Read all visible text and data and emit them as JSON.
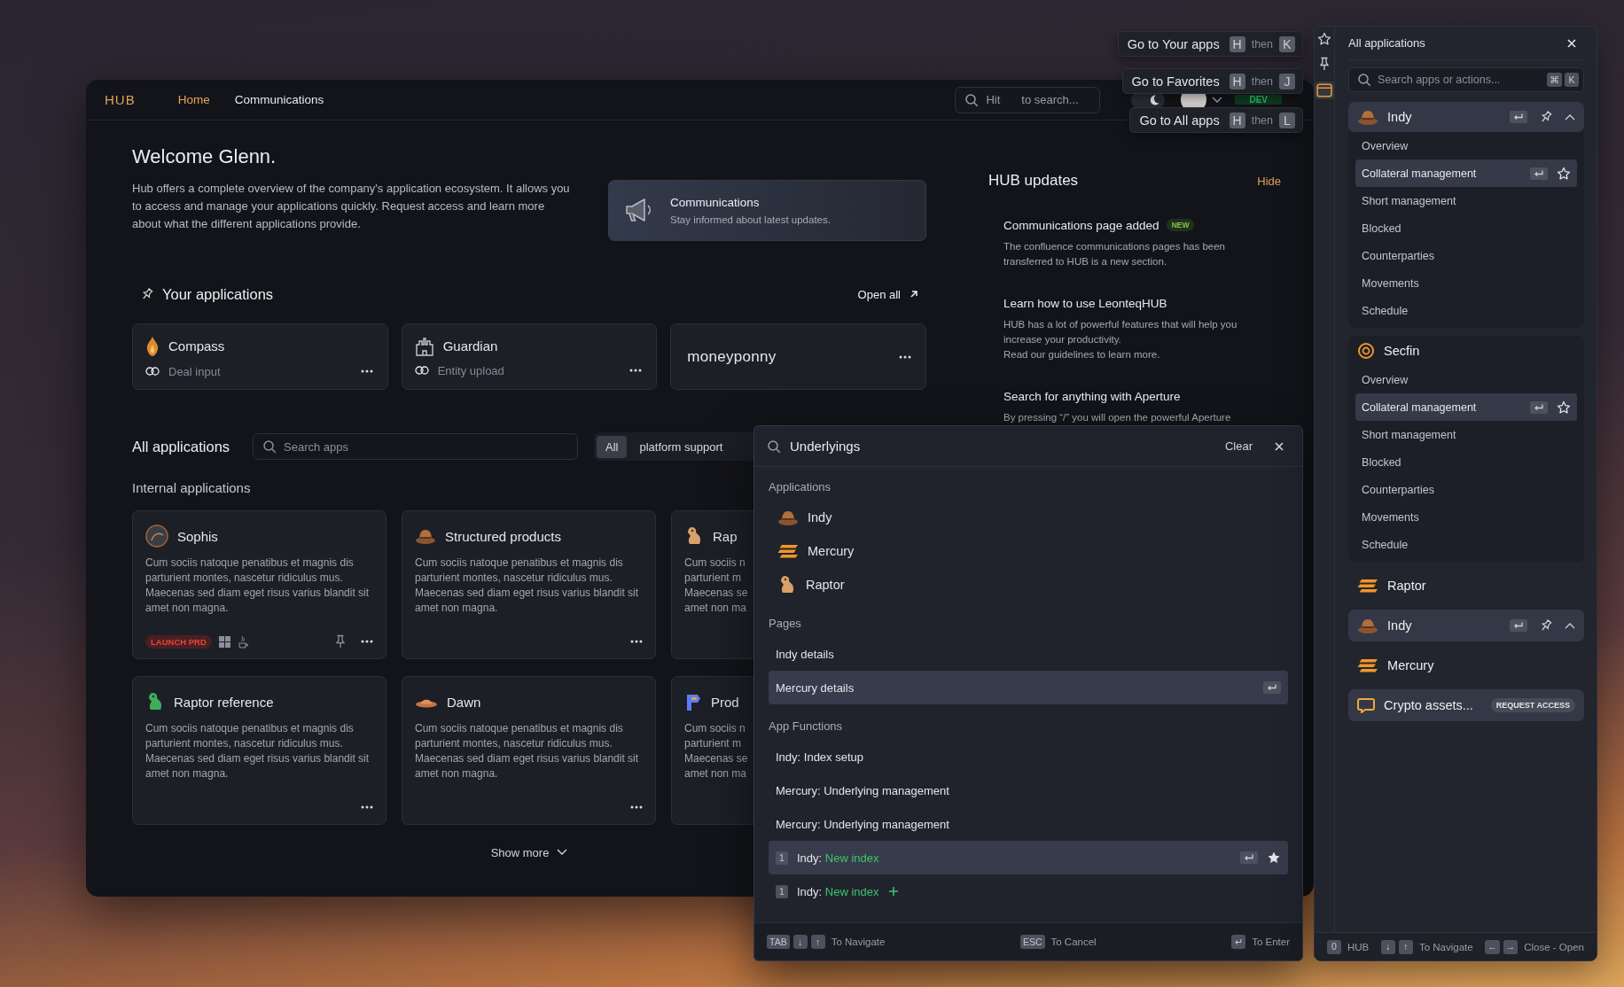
{
  "header": {
    "logo": "HUB",
    "nav": [
      {
        "label": "Home",
        "selected": true
      },
      {
        "label": "Communications",
        "selected": false
      }
    ],
    "search": {
      "hint": "Hit",
      "hint_end": "to search..."
    },
    "theme_toggle": {
      "on": true
    },
    "environment": "DEV"
  },
  "welcome": {
    "title": "Welcome Glenn.",
    "text": "Hub offers a complete overview of the company's application ecosystem. It allows you to access and manage your applications quickly. Request access and learn more about what the different applications provide."
  },
  "promo": {
    "title": "Communications",
    "subtitle": "Stay informed about latest updates."
  },
  "your_applications": {
    "title": "Your applications",
    "open_all": "Open all",
    "apps": [
      {
        "kind": "flame",
        "name": "Compass",
        "link": "Deal input"
      },
      {
        "kind": "castle",
        "name": "Guardian",
        "link": "Entity upload"
      },
      {
        "kind": "wordmark",
        "name": "moneyponny"
      }
    ]
  },
  "all_applications": {
    "title": "All applications",
    "search": {
      "placeholder": "Search apps"
    },
    "filters": [
      {
        "label": "All",
        "selected": true
      },
      {
        "label": "platform support",
        "selected": false
      }
    ],
    "section": "Internal applications",
    "cards": [
      {
        "kind": "sophis",
        "name": "Sophis",
        "description": "Cum sociis natoque penatibus et magnis dis parturient montes, nascetur ridiculus mus. Maecenas sed diam eget risus varius blandit sit amet non magna.",
        "launch_badge": "LAUNCH PRD",
        "platform_icons": true,
        "pinned": true
      },
      {
        "kind": "hat",
        "name": "Structured products",
        "description": "Cum sociis natoque penatibus et magnis dis parturient montes, nascetur ridiculus mus. Maecenas sed diam eget risus varius blandit sit amet non magna.",
        "pinned": false
      },
      {
        "kind": "dino",
        "name": "Rap",
        "description_lines": [
          "Cum sociis n",
          "parturient m",
          "Maecenas se",
          "amet non ma"
        ]
      },
      {
        "kind": "greendino",
        "name": "Raptor reference",
        "description": "Cum sociis natoque penatibus et magnis dis parturient montes, nascetur ridiculus mus. Maecenas sed diam eget risus varius blandit sit amet non magna.",
        "pinned": false
      },
      {
        "kind": "flathat",
        "name": "Dawn",
        "description": "Cum sociis natoque penatibus et magnis dis parturient montes, nascetur ridiculus mus. Maecenas sed diam eget risus varius blandit sit amet non magna.",
        "pinned": false
      },
      {
        "kind": "plogo",
        "name": "Prod",
        "description_lines": [
          "Cum sociis n",
          "parturient m",
          "Maecenas se",
          "amet non ma"
        ]
      }
    ],
    "show_more": "Show more"
  },
  "hub_updates": {
    "title": "HUB updates",
    "hide": "Hide",
    "items": [
      {
        "title": "Communications page added",
        "badge": "NEW",
        "paragraphs": [
          "The confluence communications pages has been transferred to HUB is a new section."
        ]
      },
      {
        "title": "Learn how to use LeonteqHUB",
        "paragraphs": [
          "HUB has a lot of powerful features that will help you increase your productivity.",
          "Read our guidelines to learn more."
        ]
      },
      {
        "title": "Search for anything with Aperture",
        "paragraphs": [
          "By pressing “/” you will open the powerful Aperture"
        ]
      }
    ]
  },
  "shortcuts": [
    {
      "label": "Go to Your apps",
      "first_key": "H",
      "joiner": "then",
      "second_key": "K"
    },
    {
      "label": "Go to Favorites",
      "first_key": "H",
      "joiner": "then",
      "second_key": "J"
    },
    {
      "label": "Go to All apps",
      "first_key": "H",
      "joiner": "then",
      "second_key": "L"
    }
  ],
  "aperture": {
    "query": "Underlyings",
    "clear": "Clear",
    "sections": [
      {
        "title": "Applications",
        "items": [
          {
            "kind": "app",
            "icon": {
              "kind": "hat"
            },
            "label": "Indy",
            "selected": false
          },
          {
            "kind": "app",
            "icon": {
              "kind": "stripes"
            },
            "label": "Mercury",
            "selected": false
          },
          {
            "kind": "app",
            "icon": {
              "kind": "dino"
            },
            "label": "Raptor",
            "selected": false
          }
        ]
      },
      {
        "title": "Pages",
        "items": [
          {
            "kind": "page",
            "label": "Indy details",
            "selected": false
          },
          {
            "kind": "page",
            "label": "Mercury details",
            "selected": true
          }
        ]
      },
      {
        "title": "App Functions",
        "items": [
          {
            "kind": "function",
            "label": "Indy: Index setup",
            "selected": false
          },
          {
            "kind": "function",
            "label": "Mercury: Underlying management",
            "selected": false
          },
          {
            "kind": "function",
            "label": "Mercury: Underlying management",
            "selected": false
          },
          {
            "kind": "action",
            "number": "1",
            "prefix": "Indy:",
            "highlight": "New index",
            "selected": true,
            "starred": true,
            "addable": false
          },
          {
            "kind": "action",
            "number": "1",
            "prefix": "Indy:",
            "highlight": "New index",
            "selected": false,
            "starred": false,
            "addable": true
          }
        ]
      }
    ],
    "footer": [
      {
        "keys": [
          "TAB",
          "↓",
          "↑"
        ],
        "label": "To Navigate"
      },
      {
        "keys": [
          "ESC"
        ],
        "label": "To Cancel"
      },
      {
        "keys": [
          "↵"
        ],
        "label": "To Enter"
      }
    ]
  },
  "apps_panel": {
    "title": "All applications",
    "search": {
      "placeholder": "Search apps or actions...",
      "keys": [
        "⌘",
        "K"
      ]
    },
    "apps": [
      {
        "kind": "hat",
        "name": "Indy",
        "highlighted": true,
        "focused": true,
        "children": [
          {
            "label": "Overview",
            "selected": false
          },
          {
            "label": "Collateral management",
            "selected": true
          },
          {
            "label": "Short management",
            "selected": false
          },
          {
            "label": "Blocked",
            "selected": false
          },
          {
            "label": "Counterparties",
            "selected": false
          },
          {
            "label": "Movements",
            "selected": false
          },
          {
            "label": "Schedule",
            "selected": false
          }
        ]
      },
      {
        "kind": "coin",
        "name": "Secfin",
        "highlighted": false,
        "focused": false,
        "children": [
          {
            "label": "Overview",
            "selected": false
          },
          {
            "label": "Collateral management",
            "selected": true
          },
          {
            "label": "Short management",
            "selected": false
          },
          {
            "label": "Blocked",
            "selected": false
          },
          {
            "label": "Counterparties",
            "selected": false
          },
          {
            "label": "Movements",
            "selected": false
          },
          {
            "label": "Schedule",
            "selected": false
          }
        ]
      },
      {
        "kind": "stripes",
        "name": "Raptor",
        "highlighted": false,
        "focused": false
      },
      {
        "kind": "hat",
        "name": "Indy",
        "highlighted": true,
        "focused": true
      },
      {
        "kind": "stripes",
        "name": "Mercury",
        "highlighted": false,
        "focused": false
      },
      {
        "kind": "chat",
        "name": "Crypto assets...",
        "highlighted": true,
        "focused": false,
        "badge": "REQUEST ACCESS"
      }
    ],
    "footer": [
      {
        "keys": [
          "0"
        ],
        "label": "HUB"
      },
      {
        "keys": [
          "↓",
          "↑"
        ],
        "label": "To Navigate"
      },
      {
        "keys": [
          "←",
          "→"
        ],
        "label": "Close - Open"
      }
    ]
  }
}
